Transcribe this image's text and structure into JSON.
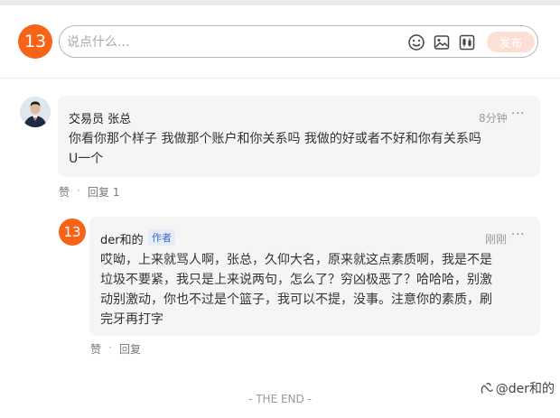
{
  "composer": {
    "avatar_number": "13",
    "placeholder": "说点什么...",
    "post_label": "发布",
    "icons": [
      "emoji-icon",
      "image-icon",
      "stock-icon"
    ]
  },
  "comments": [
    {
      "author": "交易员 张总",
      "time": "8分钟",
      "more": "···",
      "content": "你看你那个样子 我做那个账户和你关系吗   我做的好或者不好和你有关系吗",
      "content_line2": "U一个",
      "like_label": "赞",
      "separator": "·",
      "reply_label": "回复 1"
    },
    {
      "avatar_number": "13",
      "author": "der和的",
      "author_tag": "作者",
      "time": "刚刚",
      "more": "···",
      "lines": [
        "哎呦，上来就骂人啊，张总，久仰大名，原来就这点素质啊，我是不是",
        "垃圾不要紧，我只是上来说两句，怎么了？穷凶极恶了？哈哈哈，别激",
        "动别激动，你也不过是个篮子，我可以不提，没事。注意你的素质，刷",
        "完牙再打字"
      ],
      "like_label": "赞",
      "separator": "·",
      "reply_label": "回复"
    }
  ],
  "footer": {
    "end_text": "- THE END -"
  },
  "watermark": {
    "text": "@der和的"
  },
  "colors": {
    "accent": "#f86417",
    "post_button_bg": "#fde0d5",
    "card_bg": "#f5f5f6",
    "tag_blue": "#3b66c4"
  }
}
